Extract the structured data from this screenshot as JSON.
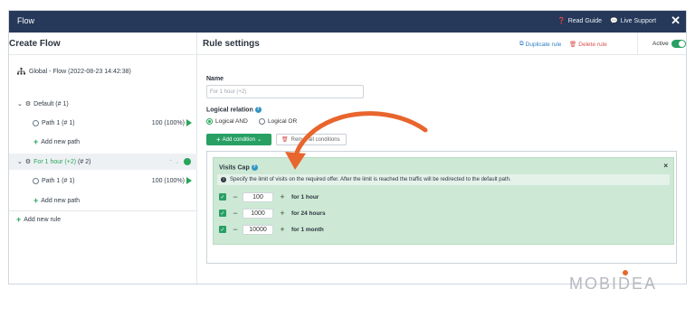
{
  "titlebar": {
    "title": "Flow",
    "read_guide": "Read Guide",
    "live_support": "Live Support",
    "close_glyph": "✕"
  },
  "left": {
    "heading": "Create Flow",
    "global_label": "Global - Flow (2022-08-23 14:42:38)",
    "rules": [
      {
        "name": "Default (# 1)",
        "path": "Path 1 (# 1)",
        "percent": "100 (100%)",
        "add_path": "Add new path"
      },
      {
        "name": "For 1 hour (+2)",
        "id": "(# 2)",
        "path": "Path 1 (# 1)",
        "percent": "100 (100%)",
        "add_path": "Add new path"
      }
    ],
    "add_rule": "Add new rule"
  },
  "right": {
    "heading": "Rule settings",
    "duplicate": "Duplicate rule",
    "delete": "Delete rule",
    "active_label": "Active",
    "active": true,
    "name_label": "Name",
    "name_placeholder": "For 1 hour (+2)",
    "logical_label": "Logical relation",
    "logical_and": "Logical AND",
    "logical_or": "Logical OR",
    "add_condition": "Add condition",
    "remove_conditions": "Remove all conditions",
    "remove_conditions_visible": "Rem... all conditions"
  },
  "condition": {
    "title": "Visits Cap",
    "info": "Specify the limit of visits on the required offer. After the limit is reached the traffic will be redirected to the default path.",
    "caps": [
      {
        "value": "100",
        "period": "for 1 hour"
      },
      {
        "value": "1000",
        "period": "for 24 hours"
      },
      {
        "value": "10000",
        "period": "for 1 month"
      }
    ]
  },
  "brand": {
    "logo": "MOBIDEA",
    "accent": "#e8652d",
    "primary": "#28a064",
    "header": "#26395a"
  }
}
